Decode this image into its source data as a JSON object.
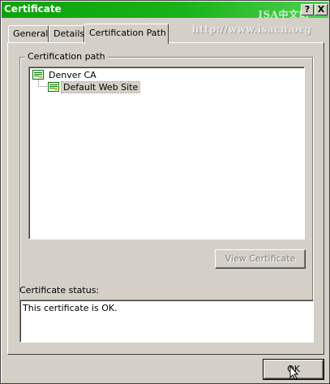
{
  "window": {
    "title": "Certificate",
    "watermark_line1": "ISA中文站",
    "watermark_line2": "http://www.isacn.org",
    "help_label": "?",
    "close_label": "X"
  },
  "tabs": [
    {
      "label": "General"
    },
    {
      "label": "Details"
    },
    {
      "label": "Certification Path",
      "active": true
    }
  ],
  "path_group": {
    "label": "Certification path",
    "nodes": [
      {
        "label": "Denver CA",
        "icon": "certificate-icon"
      },
      {
        "label": "Default Web Site",
        "icon": "certificate-icon",
        "selected": true
      }
    ],
    "view_button": "View Certificate"
  },
  "status": {
    "label": "Certificate status:",
    "text": "This certificate is OK."
  },
  "ok_button": "OK"
}
